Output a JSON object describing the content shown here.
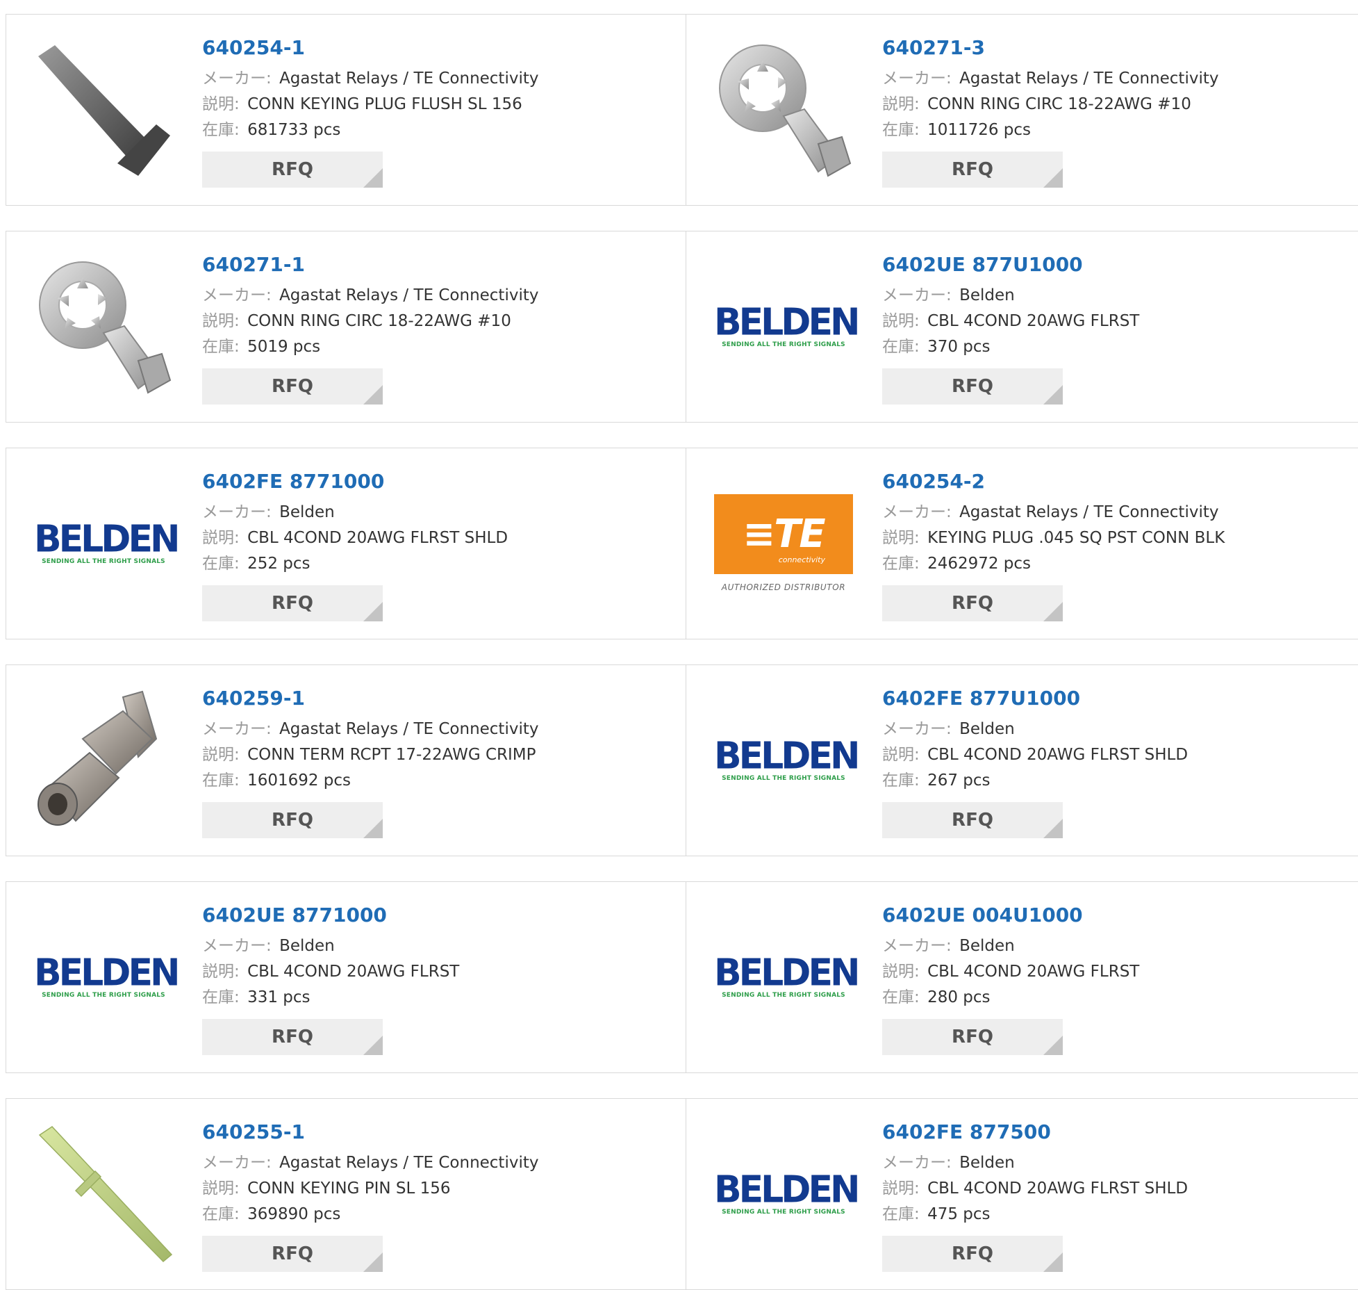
{
  "labels": {
    "maker": "メーカー:",
    "description": "説明:",
    "stock": "在庫:",
    "rfq": "RFQ"
  },
  "brand_logos": {
    "belden_word": "BELDEN",
    "belden_tagline": "SENDING ALL THE RIGHT SIGNALS",
    "te_word": "TE",
    "te_sub": "connectivity",
    "te_authorized": "AUTHORIZED DISTRIBUTOR"
  },
  "colors": {
    "part_link": "#1f6cb5",
    "belden_blue": "#123a8f",
    "belden_green": "#2e9e4a",
    "te_orange": "#f28c1c"
  },
  "products": [
    {
      "part": "640254-1",
      "maker": "Agastat Relays / TE Connectivity",
      "description": "CONN KEYING PLUG FLUSH SL 156",
      "stock": "681733 pcs",
      "image": "keying-plug"
    },
    {
      "part": "640271-3",
      "maker": "Agastat Relays / TE Connectivity",
      "description": "CONN RING CIRC 18-22AWG #10",
      "stock": "1011726 pcs",
      "image": "ring-terminal"
    },
    {
      "part": "640271-1",
      "maker": "Agastat Relays / TE Connectivity",
      "description": "CONN RING CIRC 18-22AWG #10",
      "stock": "5019 pcs",
      "image": "ring-terminal"
    },
    {
      "part": "6402UE 877U1000",
      "maker": "Belden",
      "description": "CBL 4COND 20AWG FLRST",
      "stock": "370 pcs",
      "image": "belden-logo"
    },
    {
      "part": "6402FE 8771000",
      "maker": "Belden",
      "description": "CBL 4COND 20AWG FLRST SHLD",
      "stock": "252 pcs",
      "image": "belden-logo"
    },
    {
      "part": "640254-2",
      "maker": "Agastat Relays / TE Connectivity",
      "description": "KEYING PLUG .045 SQ PST CONN BLK",
      "stock": "2462972 pcs",
      "image": "te-logo"
    },
    {
      "part": "640259-1",
      "maker": "Agastat Relays / TE Connectivity",
      "description": "CONN TERM RCPT 17-22AWG CRIMP",
      "stock": "1601692 pcs",
      "image": "receptacle-terminal"
    },
    {
      "part": "6402FE 877U1000",
      "maker": "Belden",
      "description": "CBL 4COND 20AWG FLRST SHLD",
      "stock": "267 pcs",
      "image": "belden-logo"
    },
    {
      "part": "6402UE 8771000",
      "maker": "Belden",
      "description": "CBL 4COND 20AWG FLRST",
      "stock": "331 pcs",
      "image": "belden-logo"
    },
    {
      "part": "6402UE 004U1000",
      "maker": "Belden",
      "description": "CBL 4COND 20AWG FLRST",
      "stock": "280 pcs",
      "image": "belden-logo"
    },
    {
      "part": "640255-1",
      "maker": "Agastat Relays / TE Connectivity",
      "description": "CONN KEYING PIN SL 156",
      "stock": "369890 pcs",
      "image": "keying-pin"
    },
    {
      "part": "6402FE 877500",
      "maker": "Belden",
      "description": "CBL 4COND 20AWG FLRST SHLD",
      "stock": "475 pcs",
      "image": "belden-logo"
    }
  ]
}
